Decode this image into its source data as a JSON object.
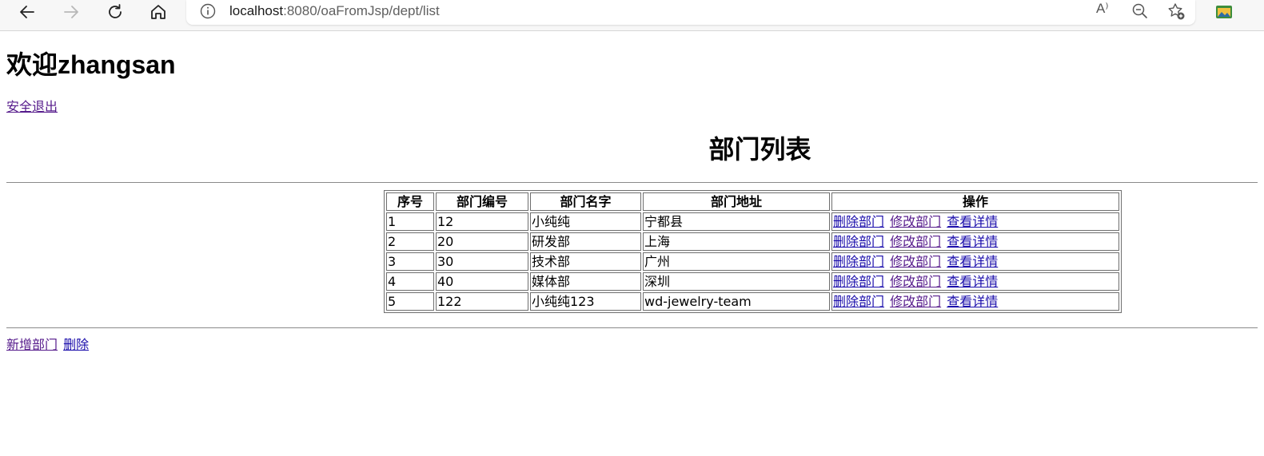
{
  "browser": {
    "url_host": "localhost",
    "url_rest": ":8080/oaFromJsp/dept/list",
    "read_aloud_glyph": "A⁾"
  },
  "page": {
    "welcome": "欢迎zhangsan",
    "logout_label": "安全退出",
    "title": "部门列表"
  },
  "table": {
    "headers": [
      "序号",
      "部门编号",
      "部门名字",
      "部门地址",
      "操作"
    ],
    "rows": [
      {
        "seq": "1",
        "deptno": "12",
        "dname": "小纯纯",
        "loc": "宁都县"
      },
      {
        "seq": "2",
        "deptno": "20",
        "dname": "研发部",
        "loc": "上海"
      },
      {
        "seq": "3",
        "deptno": "30",
        "dname": "技术部",
        "loc": "广州"
      },
      {
        "seq": "4",
        "deptno": "40",
        "dname": "媒体部",
        "loc": "深圳"
      },
      {
        "seq": "5",
        "deptno": "122",
        "dname": "小纯纯123",
        "loc": "wd-jewelry-team"
      }
    ],
    "actions": {
      "delete": "删除部门",
      "edit": "修改部门",
      "detail": "查看详情"
    }
  },
  "footer": {
    "add_label": "新增部门",
    "delete_label": "删除"
  },
  "colors": {
    "link": "#1a0dab",
    "visited_link": "#551a8b"
  }
}
